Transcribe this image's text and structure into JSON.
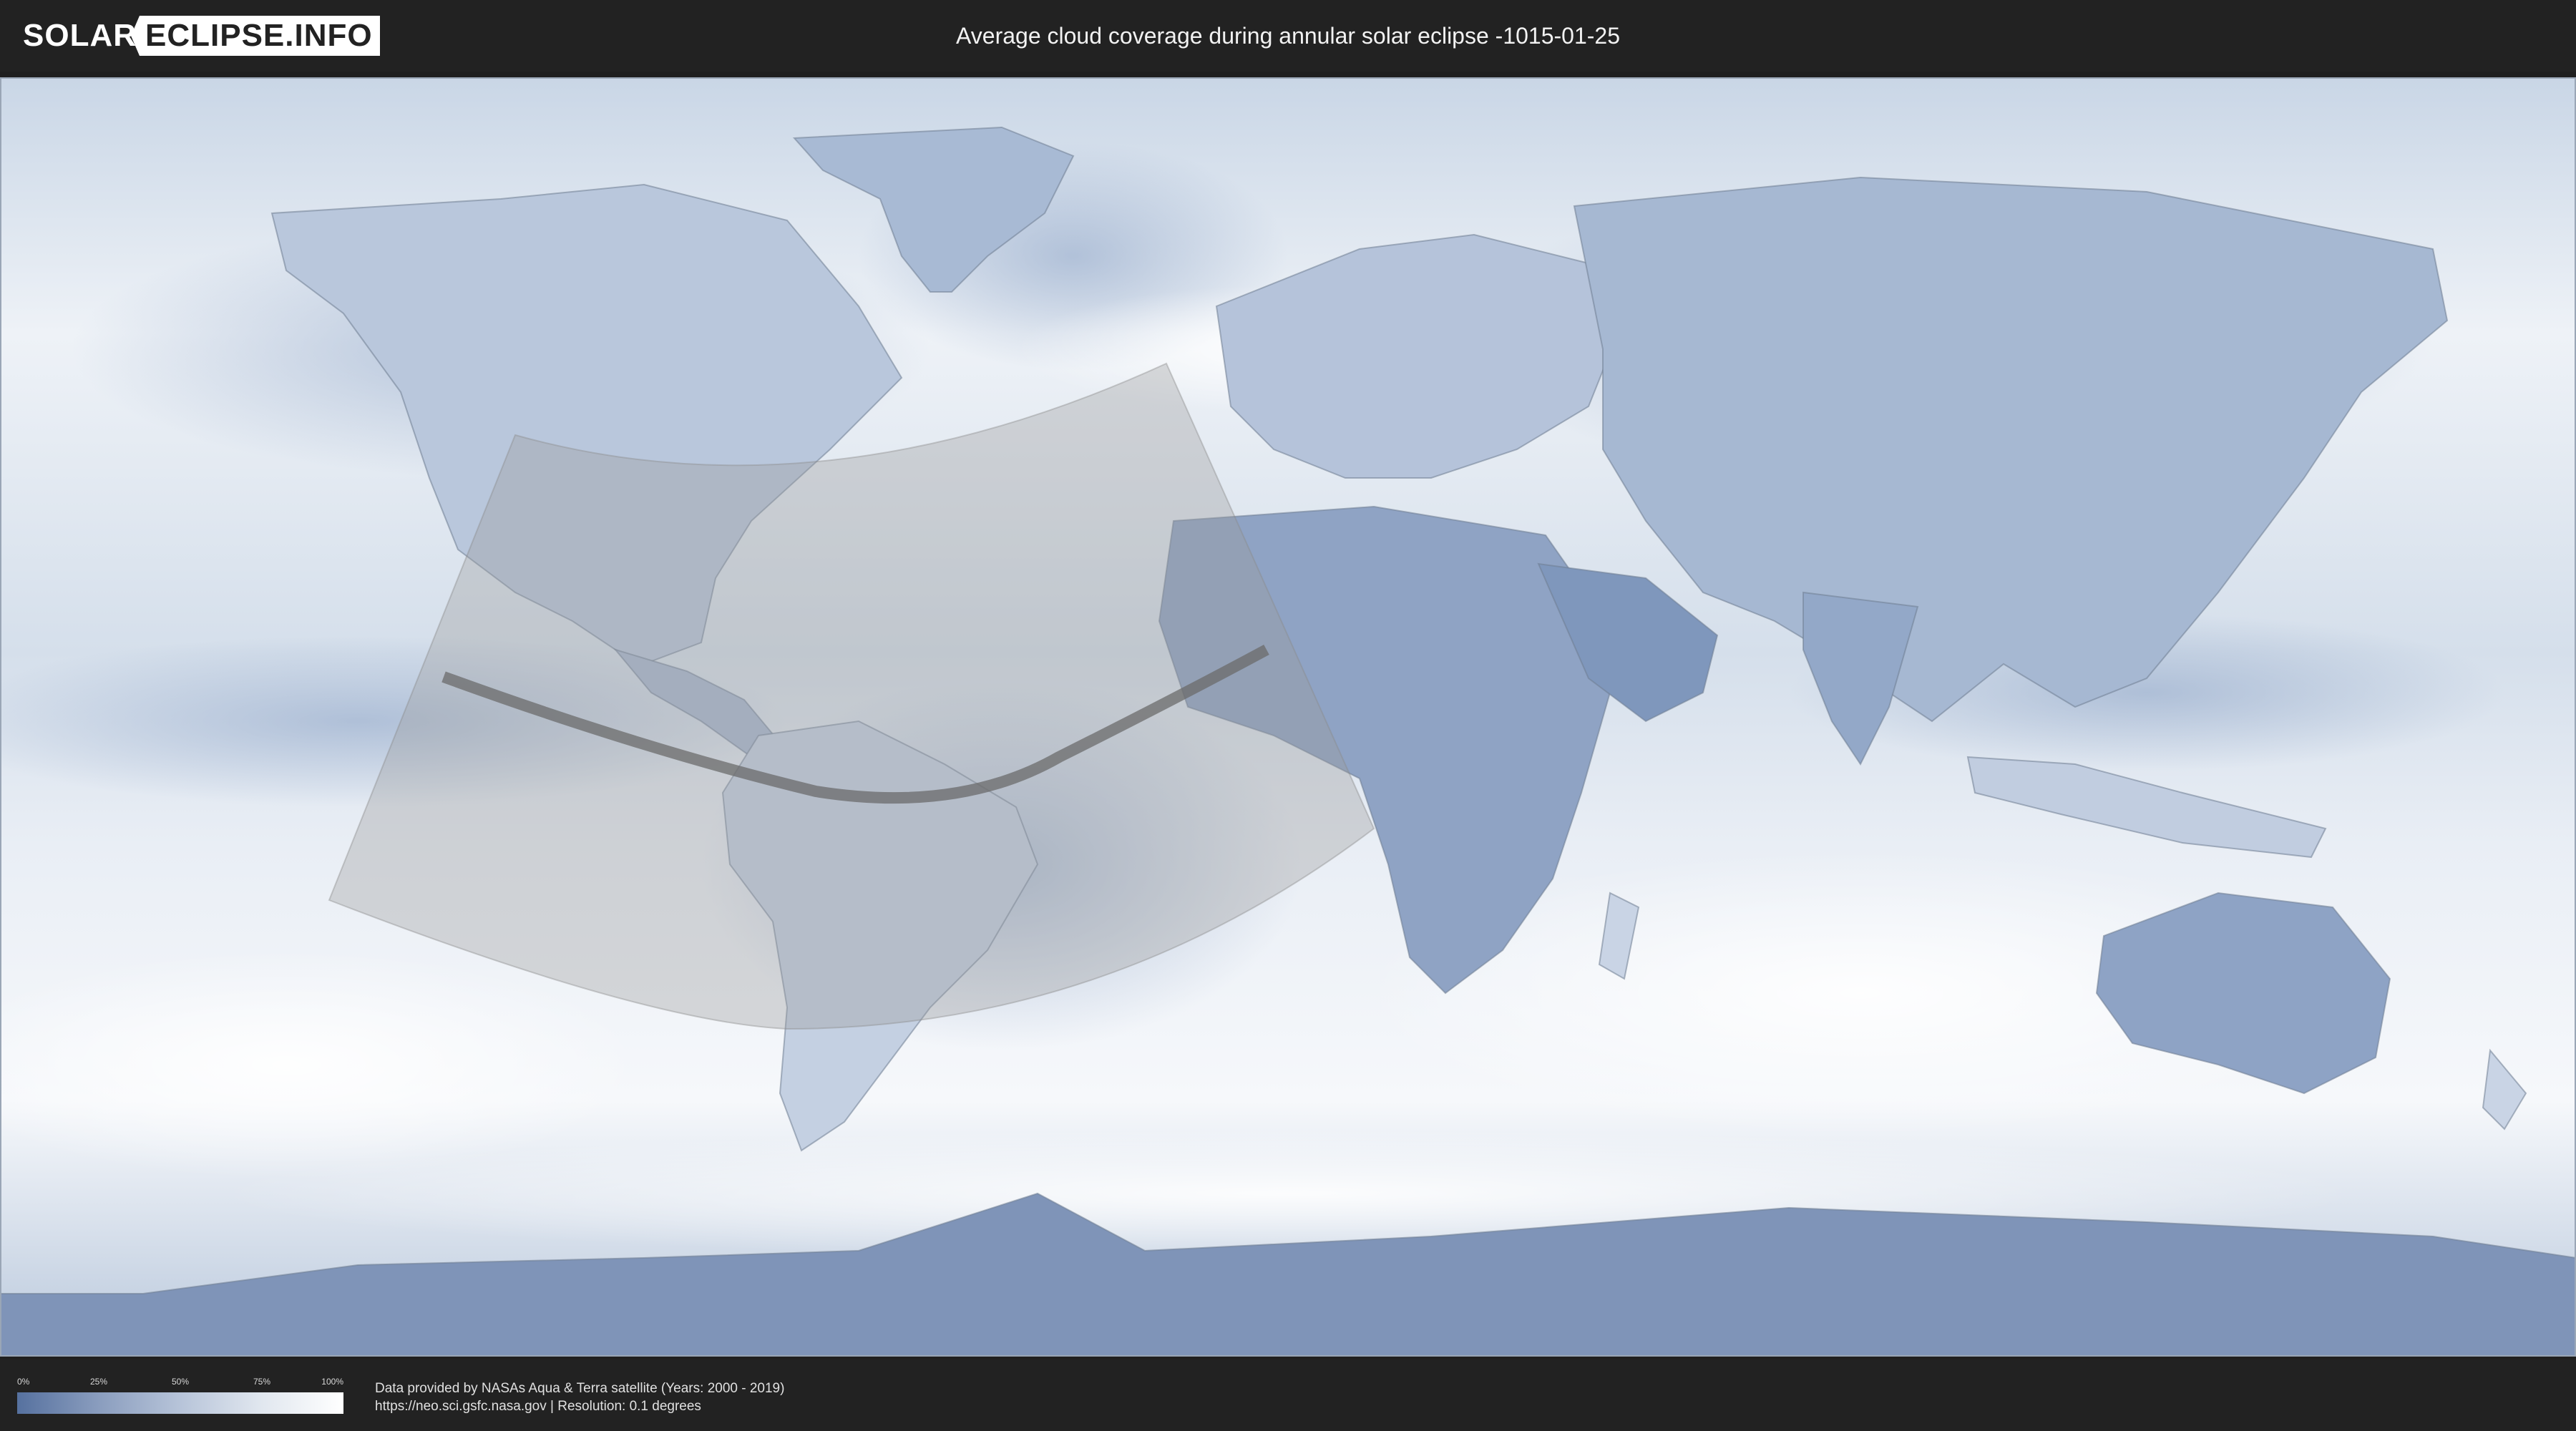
{
  "header": {
    "logo_part1": "SOLAR",
    "logo_part2": "ECLIPSE.INFO",
    "title": "Average cloud coverage during annular solar eclipse -1015-01-25"
  },
  "map": {
    "colors": {
      "ocean_clear": "#e7edf4",
      "cloud_low": "#56719f",
      "cloud_mid": "#9fb2cf",
      "cloud_high": "#ffffff",
      "eclipse_zone": "#9a9a9a",
      "central_line": "#6b6b6b"
    }
  },
  "legend": {
    "ticks": [
      "0%",
      "25%",
      "50%",
      "75%",
      "100%"
    ]
  },
  "credits": {
    "line1": "Data provided by NASAs Aqua & Terra satellite (Years: 2000 - 2019)",
    "line2": "https://neo.sci.gsfc.nasa.gov | Resolution: 0.1 degrees"
  }
}
